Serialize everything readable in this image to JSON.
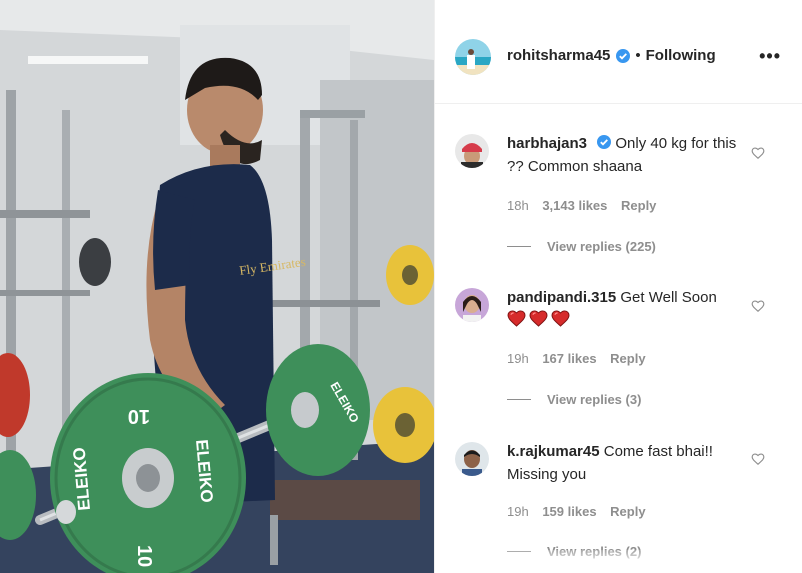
{
  "post": {
    "username": "rohitsharma45",
    "separator": "•",
    "follow_status": "Following",
    "more_icon": "•••"
  },
  "media": {
    "plate_brand": "ELEIKO",
    "plate_weight": "10",
    "shirt_text": "Fly Emirates"
  },
  "comments": [
    {
      "username": "harbhajan3",
      "verified": true,
      "text": "Only 40 kg for this ?? Common shaana",
      "time": "18h",
      "likes": "3,143 likes",
      "reply": "Reply",
      "view_replies": "View replies (225)"
    },
    {
      "username": "pandipandi.315",
      "verified": false,
      "text": "Get Well Soon",
      "emoji": [
        "heart",
        "heart",
        "heart"
      ],
      "time": "19h",
      "likes": "167 likes",
      "reply": "Reply",
      "view_replies": "View replies (3)"
    },
    {
      "username": "k.rajkumar45",
      "verified": false,
      "text": "Come fast bhai!! Missing you",
      "time": "19h",
      "likes": "159 likes",
      "reply": "Reply",
      "view_replies": "View replies (2)"
    }
  ],
  "colors": {
    "verified_blue": "#3897f0",
    "meta_gray": "#8e8e8e",
    "plate_green": "#3e8f5a",
    "plate_yellow": "#e8c23a",
    "plate_red": "#c0392b",
    "shirt_navy": "#1c2b4a",
    "heart_red": "#d62b2b"
  }
}
